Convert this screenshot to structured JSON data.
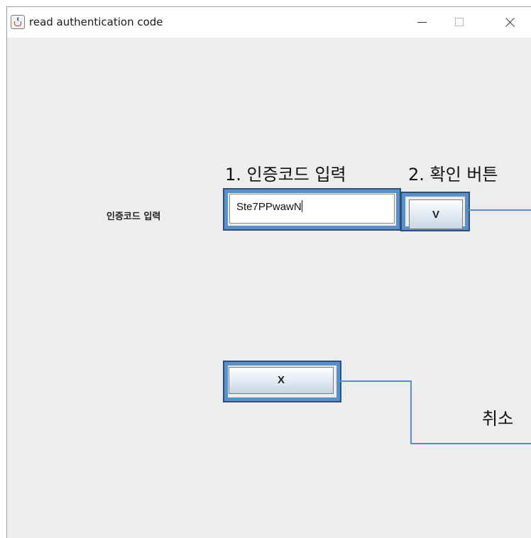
{
  "window": {
    "title": "read authentication code",
    "controls": {
      "minimize": "minimize-icon",
      "maximize": "maximize-icon",
      "close": "close-icon"
    }
  },
  "form": {
    "code_label": "인증코드 입력",
    "code_value": "Ste7PPwawN",
    "confirm_label": "V",
    "cancel_label": "X"
  },
  "annotations": {
    "input_callout": "1. 인증코드 입력",
    "confirm_callout": "2. 확인 버튼",
    "cancel_callout": "취소"
  },
  "colors": {
    "highlight": "#5b8fc7",
    "window_bg": "#ededed"
  }
}
